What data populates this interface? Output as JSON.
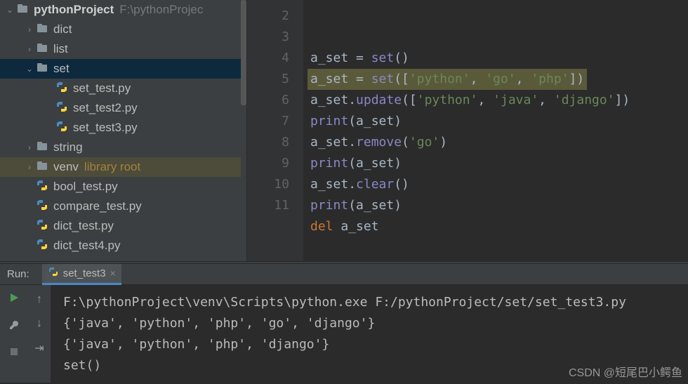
{
  "tree": {
    "project": {
      "name": "pythonProject",
      "path": "F:\\pythonProjec"
    },
    "items": [
      {
        "indent": 1,
        "chevron": "›",
        "kind": "folder",
        "label": "dict"
      },
      {
        "indent": 1,
        "chevron": "›",
        "kind": "folder",
        "label": "list"
      },
      {
        "indent": 1,
        "chevron": "⌄",
        "kind": "folder",
        "label": "set",
        "selected": true
      },
      {
        "indent": 2,
        "chevron": "",
        "kind": "pyfile",
        "label": "set_test.py"
      },
      {
        "indent": 2,
        "chevron": "",
        "kind": "pyfile",
        "label": "set_test2.py"
      },
      {
        "indent": 2,
        "chevron": "",
        "kind": "pyfile",
        "label": "set_test3.py"
      },
      {
        "indent": 1,
        "chevron": "›",
        "kind": "folder",
        "label": "string"
      },
      {
        "indent": 1,
        "chevron": "›",
        "kind": "folder",
        "label": "venv",
        "suffix": "library root",
        "venv": true
      },
      {
        "indent": 1,
        "chevron": "",
        "kind": "pyfile",
        "label": "bool_test.py"
      },
      {
        "indent": 1,
        "chevron": "",
        "kind": "pyfile",
        "label": "compare_test.py"
      },
      {
        "indent": 1,
        "chevron": "",
        "kind": "pyfile",
        "label": "dict_test.py"
      },
      {
        "indent": 1,
        "chevron": "",
        "kind": "pyfile",
        "label": "dict_test4.py"
      }
    ]
  },
  "editor": {
    "lines": [
      2,
      3,
      4,
      5,
      6,
      7,
      8,
      9,
      10,
      11
    ],
    "code": {
      "l3_var": "a_set",
      "l3_eq": " = ",
      "l3_set": "set",
      "l3_tail": "()",
      "l4_var": "a_set",
      "l4_eq": " = ",
      "l4_set": "set",
      "l4_mid1": "([",
      "l4_s1": "'python'",
      "l4_c1": ", ",
      "l4_s2": "'go'",
      "l4_c2": ", ",
      "l4_s3": "'php'",
      "l4_end": "])",
      "l5_var": "a_set",
      "l5_dot": ".",
      "l5_fn": "update",
      "l5_mid1": "([",
      "l5_s1": "'python'",
      "l5_c1": ", ",
      "l5_s2": "'java'",
      "l5_c2": ", ",
      "l5_s3": "'django'",
      "l5_end": "])",
      "l6_print": "print",
      "l6_body": "(a_set)",
      "l7_var": "a_set",
      "l7_dot": ".",
      "l7_fn": "remove",
      "l7_open": "(",
      "l7_s": "'go'",
      "l7_close": ")",
      "l8_print": "print",
      "l8_body": "(a_set)",
      "l9_var": "a_set",
      "l9_dot": ".",
      "l9_fn": "clear",
      "l9_tail": "()",
      "l10_print": "print",
      "l10_body": "(a_set)",
      "l11_del": "del ",
      "l11_var": "a_set"
    }
  },
  "run": {
    "label": "Run:",
    "tab": "set_test3",
    "output": [
      "F:\\pythonProject\\venv\\Scripts\\python.exe F:/pythonProject/set/set_test3.py",
      "{'java', 'python', 'php', 'go', 'django'}",
      "{'java', 'python', 'php', 'django'}",
      "set()"
    ]
  },
  "watermark": "CSDN @短尾巴小鳄鱼"
}
